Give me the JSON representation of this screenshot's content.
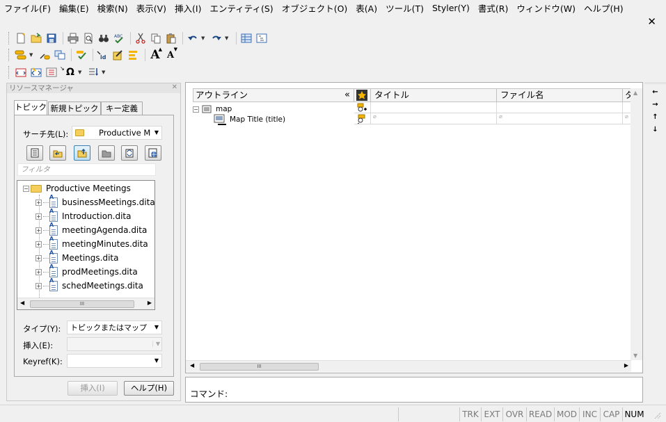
{
  "menubar": {
    "items": [
      "ファイル(F)",
      "編集(E)",
      "検索(N)",
      "表示(V)",
      "挿入(I)",
      "エンティティ(S)",
      "オブジェクト(O)",
      "表(A)",
      "ツール(T)",
      "Styler(Y)",
      "書式(R)",
      "ウィンドウ(W)",
      "ヘルプ(H)"
    ],
    "close_glyph": "✕"
  },
  "toolbar": {
    "font_grow": "A",
    "font_shrink": "A",
    "omega": "Ω"
  },
  "resource_manager": {
    "title": "リソースマネージャ",
    "close_glyph": "✕",
    "tabs": [
      "トピック",
      "新規トピック",
      "キー定義"
    ],
    "search_label": "サーチ先(L):",
    "search_value": "Productive M",
    "filter_placeholder": "フィルタ",
    "tree_root": "Productive Meetings",
    "tree_items": [
      "businessMeetings.ditam",
      "Introduction.dita",
      "meetingAgenda.dita",
      "meetingMinutes.dita",
      "Meetings.dita",
      "prodMeetings.dita",
      "schedMeetings.dita"
    ],
    "scroll_grip": "III",
    "type_label": "タイプ(Y):",
    "type_value": "トピックまたはマップ",
    "insert_label": "挿入(E):",
    "insert_value": "",
    "keyref_label": "Keyref(K):",
    "keyref_value": "",
    "insert_button": "挿入(I)",
    "help_button": "ヘルプ(H)"
  },
  "document": {
    "outline_header": "アウトライン",
    "collapse_glyph": "«",
    "columns": [
      "タイトル",
      "ファイル名",
      "タ"
    ],
    "rows": [
      {
        "label": "map"
      },
      {
        "label": "Map Title (title)"
      }
    ],
    "empty_glyph": "⌀",
    "scroll_grip": "III"
  },
  "command": {
    "label": "コマンド:"
  },
  "statusbar": {
    "items": [
      "TRK",
      "EXT",
      "OVR",
      "READ",
      "MOD",
      "INC",
      "CAP",
      "NUM"
    ],
    "active": "NUM"
  },
  "colors": {
    "chrome": "#f0f0f0",
    "selection": "#bfe0f4",
    "folder": "#f5cf5c"
  }
}
